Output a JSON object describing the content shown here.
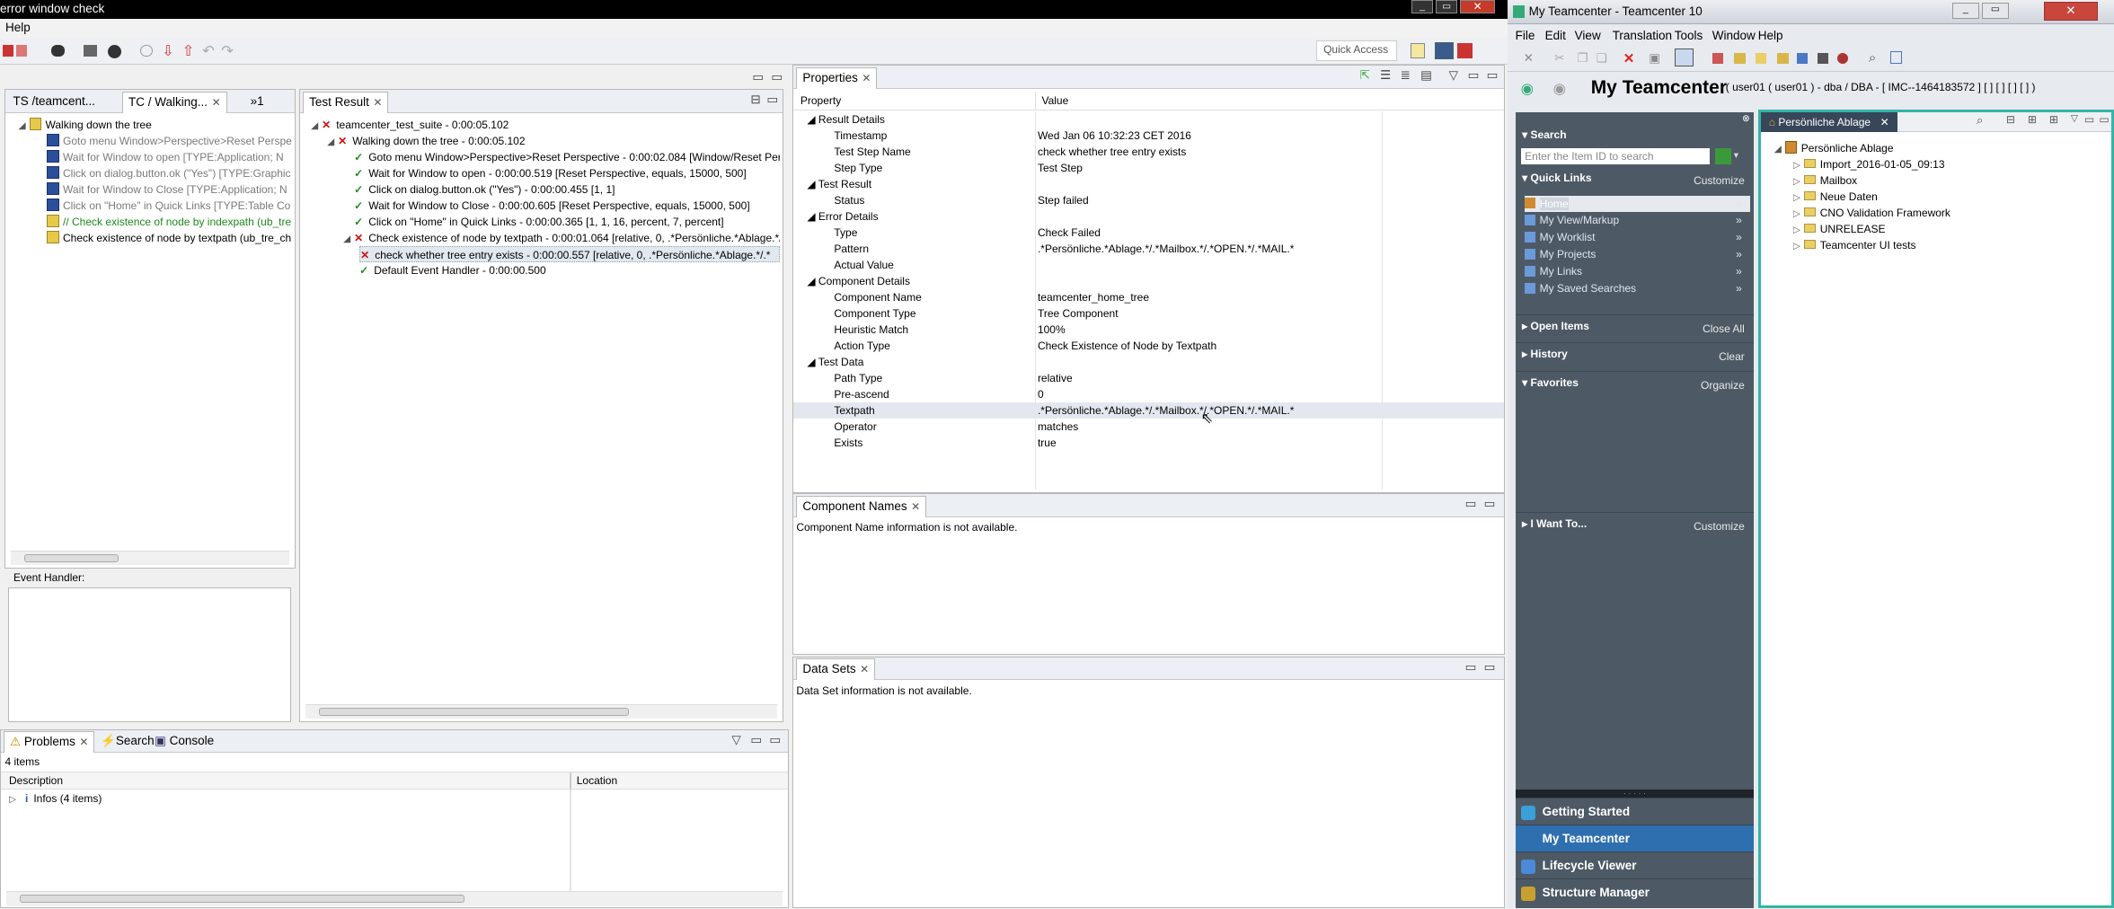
{
  "left_window": {
    "title": "error window check",
    "menu_help": "Help",
    "quick_access": "Quick Access",
    "tabs_left": [
      "TS /teamcent...",
      "TC / Walking...",
      "»1"
    ],
    "test_case_tree": [
      {
        "label": "Walking down the tree",
        "style": "normal",
        "icon": "yellow-grid-icon"
      },
      {
        "label": "Goto menu Window>Perspective>Reset Perspective",
        "style": "gray",
        "icon": "blue-square-icon"
      },
      {
        "label": "Wait for Window to open [TYPE:Application; N",
        "style": "gray",
        "icon": "blue-square-icon"
      },
      {
        "label": "Click on dialog.button.ok (\"Yes\") [TYPE:Graphic",
        "style": "gray",
        "icon": "blue-square-icon"
      },
      {
        "label": "Wait for Window to Close [TYPE:Application; N",
        "style": "gray",
        "icon": "blue-square-icon"
      },
      {
        "label": "Click on \"Home\" in Quick Links [TYPE:Table Co",
        "style": "gray",
        "icon": "blue-square-icon"
      },
      {
        "label": "// Check existence of node by indexpath (ub_tre",
        "style": "green",
        "icon": "yellow-grid-icon"
      },
      {
        "label": "Check existence of node by textpath (ub_tre_ch",
        "style": "normal",
        "icon": "yellow-grid-icon"
      }
    ],
    "event_handler_label": "Event Handler:",
    "test_result_tab": "Test Result",
    "test_result_tree": [
      {
        "label": "teamcenter_test_suite - 0:00:05.102",
        "status": "fail",
        "indent": 0
      },
      {
        "label": "Walking down the tree - 0:00:05.102",
        "status": "fail",
        "indent": 1
      },
      {
        "label": "Goto menu Window>Perspective>Reset Perspective - 0:00:02.084 [Window/Reset Per",
        "status": "pass",
        "indent": 2
      },
      {
        "label": "Wait for Window to open - 0:00:00.519 [Reset Perspective, equals, 15000, 500]",
        "status": "pass",
        "indent": 2
      },
      {
        "label": "Click on dialog.button.ok (\"Yes\") - 0:00:00.455 [1, 1]",
        "status": "pass",
        "indent": 2
      },
      {
        "label": "Wait for Window to Close - 0:00:00.605 [Reset Perspective, equals, 15000, 500]",
        "status": "pass",
        "indent": 2
      },
      {
        "label": "Click on \"Home\" in Quick Links - 0:00:00.365 [1, 1, 16, percent, 7, percent]",
        "status": "pass",
        "indent": 2
      },
      {
        "label": "Check existence of node by textpath - 0:00:01.064 [relative, 0, .*Persönliche.*Ablage.*/",
        "status": "fail",
        "indent": 2
      },
      {
        "label": "check whether tree entry exists - 0:00:00.557 [relative, 0, .*Persönliche.*Ablage.*/.*",
        "status": "fail",
        "indent": 3,
        "selected": true
      },
      {
        "label": "Default Event Handler - 0:00:00.500",
        "status": "pass",
        "indent": 3
      }
    ],
    "properties": {
      "tab": "Properties",
      "col_property": "Property",
      "col_value": "Value",
      "rows": [
        {
          "k": "Result Details",
          "v": "",
          "group": true
        },
        {
          "k": "Timestamp",
          "v": "Wed Jan 06 10:32:23 CET 2016"
        },
        {
          "k": "Test Step Name",
          "v": "check whether tree entry exists"
        },
        {
          "k": "Step Type",
          "v": "Test Step"
        },
        {
          "k": "Test Result",
          "v": "",
          "group": true
        },
        {
          "k": "Status",
          "v": "Step failed"
        },
        {
          "k": "Error Details",
          "v": "",
          "group": true
        },
        {
          "k": "Type",
          "v": "Check Failed"
        },
        {
          "k": "Pattern",
          "v": ".*Persönliche.*Ablage.*/.*Mailbox.*/.*OPEN.*/.*MAIL.*"
        },
        {
          "k": "Actual Value",
          "v": ""
        },
        {
          "k": "Component Details",
          "v": "",
          "group": true
        },
        {
          "k": "Component Name",
          "v": "teamcenter_home_tree"
        },
        {
          "k": "Component Type",
          "v": "Tree Component"
        },
        {
          "k": "Heuristic Match",
          "v": "100%"
        },
        {
          "k": "Action Type",
          "v": "Check Existence of Node by Textpath"
        },
        {
          "k": "Test Data",
          "v": "",
          "group": true
        },
        {
          "k": "Path Type",
          "v": "relative"
        },
        {
          "k": "Pre-ascend",
          "v": "0"
        },
        {
          "k": "Textpath",
          "v": ".*Persönliche.*Ablage.*/.*Mailbox.*/.*OPEN.*/.*MAIL.*",
          "selected": true
        },
        {
          "k": "Operator",
          "v": "matches"
        },
        {
          "k": "Exists",
          "v": "true"
        }
      ]
    },
    "component_names": {
      "tab": "Component Names",
      "message": "Component Name information is not available."
    },
    "data_sets": {
      "tab": "Data Sets",
      "message": "Data Set information is not available."
    },
    "problems": {
      "tabs": [
        "Problems",
        "Search",
        "Console"
      ],
      "count": "4 items",
      "col_description": "Description",
      "col_location": "Location",
      "rows": [
        "Infos (4 items)"
      ]
    }
  },
  "right_window": {
    "title": "My Teamcenter - Teamcenter 10",
    "menu": [
      "File",
      "Edit",
      "View",
      "Translation",
      "Tools",
      "Window",
      "Help"
    ],
    "app_title": "My Teamcenter",
    "user_info": "( user01 ( user01 ) - dba / DBA - [ IMC--1464183572 ] [ ] [ ] [ ] [ ] )",
    "search_header": "Search",
    "search_placeholder": "Enter the Item ID to search",
    "quick_links_header": "Quick Links",
    "customize": "Customize",
    "quick_links": [
      "Home",
      "My View/Markup",
      "My Worklist",
      "My Projects",
      "My Links",
      "My Saved Searches"
    ],
    "open_items": "Open Items",
    "close_all": "Close All",
    "history": "History",
    "clear": "Clear",
    "favorites": "Favorites",
    "organize": "Organize",
    "i_want_to": "I Want To...",
    "customize2": "Customize",
    "apps": [
      "Getting Started",
      "My Teamcenter",
      "Lifecycle Viewer",
      "Structure Manager"
    ],
    "tree_tab": "Persönliche Ablage",
    "tree": [
      {
        "label": "Persönliche Ablage",
        "indent": 0
      },
      {
        "label": "Import_2016-01-05_09:13",
        "indent": 1
      },
      {
        "label": "Mailbox",
        "indent": 1
      },
      {
        "label": "Neue Daten",
        "indent": 1
      },
      {
        "label": "CNO Validation Framework",
        "indent": 1
      },
      {
        "label": "UNRELEASE",
        "indent": 1
      },
      {
        "label": "Teamcenter UI tests",
        "indent": 1
      }
    ]
  },
  "colors": {
    "tc_sidebar": "#4d5a66",
    "tc_active_app": "#2e6fb0",
    "fail_red": "#d01010",
    "pass_green": "#1b8f1b",
    "selection": "#e3e8f0",
    "tree_border_teal": "#33b5a8"
  }
}
